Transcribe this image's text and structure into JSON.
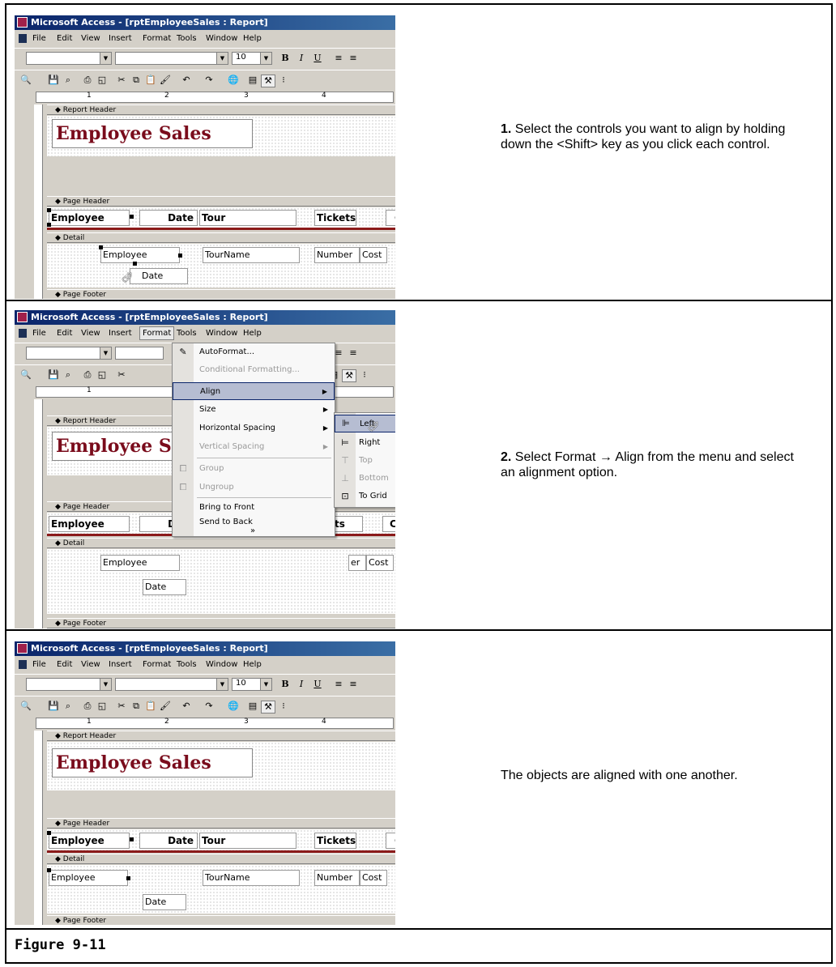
{
  "window": {
    "title": "Microsoft Access - [rptEmployeeSales : Report]",
    "menu": [
      "File",
      "Edit",
      "View",
      "Insert",
      "Format",
      "Tools",
      "Window",
      "Help"
    ],
    "font_size": "10",
    "bold_button": "B",
    "italic_button": "I",
    "underline_button": "U"
  },
  "report": {
    "report_header": "Report Header",
    "title": "Employee Sales",
    "page_header": "Page Header",
    "detail": "Detail",
    "page_footer": "Page Footer",
    "header_labels": {
      "employee": "Employee",
      "date": "Date",
      "tour": "Tour",
      "tickets": "Tickets",
      "cost_partial": "C"
    },
    "detail_fields": {
      "employee": "Employee",
      "tourname": "TourName",
      "number": "Number",
      "cost": "Cost",
      "date": "Date"
    }
  },
  "ruler_numbers": [
    "1",
    "2",
    "3",
    "4"
  ],
  "format_menu": {
    "items": [
      {
        "label": "AutoFormat...",
        "disabled": false,
        "submenu": false
      },
      {
        "label": "Conditional Formatting...",
        "disabled": true,
        "submenu": false
      },
      {
        "label": "Align",
        "disabled": false,
        "submenu": true
      },
      {
        "label": "Size",
        "disabled": false,
        "submenu": true
      },
      {
        "label": "Horizontal Spacing",
        "disabled": false,
        "submenu": true
      },
      {
        "label": "Vertical Spacing",
        "disabled": true,
        "submenu": true
      },
      {
        "label": "Group",
        "disabled": true,
        "submenu": false
      },
      {
        "label": "Ungroup",
        "disabled": true,
        "submenu": false
      },
      {
        "label": "Bring to Front",
        "disabled": false,
        "submenu": false
      },
      {
        "label": "Send to Back",
        "disabled": false,
        "submenu": false
      }
    ],
    "more": "»"
  },
  "align_submenu": {
    "items": [
      {
        "label": "Left",
        "disabled": false
      },
      {
        "label": "Right",
        "disabled": false
      },
      {
        "label": "Top",
        "disabled": true
      },
      {
        "label": "Bottom",
        "disabled": true
      },
      {
        "label": "To Grid",
        "disabled": false
      }
    ]
  },
  "panel2_partials": {
    "title": "Employee Sa",
    "date_label": "Date",
    "tickets_partial": "ts",
    "cost_partial": "Co",
    "number_partial": "er"
  },
  "steps": {
    "step1_num": "1.",
    "step1_text": "Select the controls you want to align by holding down the <Shift> key as you click each control.",
    "step2_num": "2.",
    "step2_text": "Select Format → Align from the menu and select an alignment option.",
    "step3_text": "The objects are aligned with one another."
  },
  "caption": "Figure 9-11"
}
